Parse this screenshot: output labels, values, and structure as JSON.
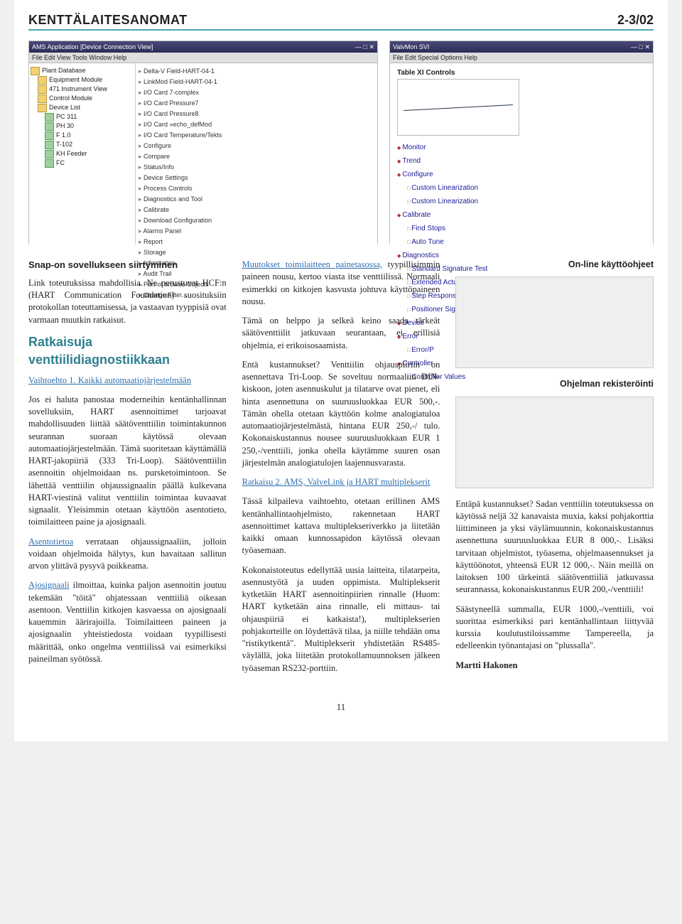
{
  "header": {
    "title": "KENTTÄLAITESANOMAT",
    "issue": "2-3/02"
  },
  "screenshots": {
    "left": {
      "window_title": "AMS Application  [Device Connection View]",
      "menubar": "File  Edit  View  Tools  Window  Help",
      "tree_items": [
        "Plant Database",
        "Equipment Module",
        "471 Instrument View",
        "Control Module",
        "Device List",
        "PC 311",
        "PH 30",
        "F 1.0",
        "T-102",
        "KH Feeder",
        "FC"
      ],
      "mid_items": [
        "Delta-V Field-HART-04-1",
        "LinkMod  Field-HART-04-1",
        "I/O Card  7-complex",
        "I/O Card  Pressure7",
        "I/O Card  Pressure8",
        "I/O Card  »echo_defMod",
        "I/O Card  Temperature/Tekts",
        "———————",
        "Configure",
        "Compare",
        "Status/Info",
        "Device Settings",
        "Process Controls",
        "Diagnostics and Tool",
        "Calibrate",
        "Download Configuration",
        "Alarms Panel",
        "Report",
        "Storage",
        "Information",
        "Audit Trail",
        "Part-of browse Objects",
        "Change Filter..."
      ]
    },
    "right": {
      "window_title": "ValvMon SVI",
      "menubar": "File  Edit  Special  Options  Help",
      "tabhead": "Table XI Controls",
      "menu": [
        "Monitor",
        "Trend",
        "Configure",
        "Calibrate",
        "Diagnostics",
        "Device",
        "Error",
        "Controller"
      ],
      "sub_configure": [
        "Custom Linearization",
        "Custom Linearization"
      ],
      "sub_calibrate": [
        "Find Stops",
        "Auto Tune"
      ],
      "sub_diagnostics": [
        "Standard Signature Test",
        "Extended Actuator Signature Test",
        "Step Response Test",
        "Positioner Signature"
      ],
      "sub_error": [
        "Error/P"
      ],
      "sub_controller": [
        "Controller Values"
      ]
    }
  },
  "article": {
    "snap_heading": "Snap-on sovellukseen siirtyminen",
    "snap_p": "Link toteutuksissa mahdollisia. Ne perustuvat HCF:n (HART Communication Foundation) suosituksiin protokollan toteuttamisessa, ja vastaavan tyyppisiä ovat varmaan muutkin ratkaisut.",
    "blue_heading": "Ratkaisuja venttiilidiagnostiikkaan",
    "opt1_link": "Vaihtoehto 1. Kaikki automaatiojärjestelmään",
    "opt1_p1": "Jos ei haluta panostaa moderneihin kentänhallinnan sovelluksiin, HART asennoittimet tarjoavat mahdollisuuden liittää säätöventtiilin toimintakunnon seurannan suoraan käytössä olevaan automaatiojärjestelmään. Tämä suoritetaan käyttämällä HART-jakopiiriä (333 Tri-Loop). Säätöventtiilin asennoitin ohjelmoidaan ns. pursketoimintoon. Se lähettää venttiilin ohjaussignaalin päällä kulkevana HART-viestinä valitut venttiilin toimintaa kuvaavat signaalit. Yleisimmin otetaan käyttöön asentotieto, toimilaitteen paine ja ajosignaali.",
    "opt1_p2_linkword": "Asentotietoa",
    "opt1_p2_rest": " verrataan ohjaussignaaliin, jolloin voidaan ohjelmoida hälytys, kun havaitaan sallitun arvon ylittävä pysyvä poikkeama.",
    "opt1_p3_linkword": "Ajosignaali",
    "opt1_p3_rest": " ilmoittaa, kuinka paljon asennoitin joutuu tekemään \"töitä\" ohjatessaan venttiiliä oikeaan asentoon. Venttiilin kitkojen kasvaessa on ajosignaali kauemmin äärirajoilla. Toimilaitteen paineen ja ajosignaalin yhteistiedosta voidaan tyypillisesti määrittää, onko ongelma venttiilissä vai esimerkiksi paineilman syötössä.",
    "col2_link1": "Muutokset toimilaitteen painetasossa,",
    "col2_p1_rest": " tyypillisimmin paineen nousu, kertoo viasta itse venttiilissä. Normaali esimerkki on kitkojen kasvusta johtuva käyttöpaineen nousu.",
    "col2_p2": "Tämä on helppo ja selkeä keino saada tärkeät säätöventtiilit jatkuvaan seurantaan, ei erillisiä ohjelmia, ei erikoisosaamista.",
    "col2_p3": "Entä kustannukset? Venttiilin ohjauspiiriin on asennettava Tri-Loop. Se soveltuu normaaliin DIN-kiskoon, joten asennuskulut ja tilatarve ovat pienet, eli hinta asennettuna on suuruusluokkaa EUR 500,-. Tämän ohella otetaan käyttöön kolme analogiatuloa automaatiojärjestelmästä, hintana EUR 250,-/ tulo. Kokonaiskustannus nousee suuruusluokkaan EUR 1 250,-/venttiili, jonka ohella käytämme suuren osan järjestelmän analogiatulojen laajennusvarasta.",
    "sol2_link": "Ratkaisu 2. AMS, ValveLink ja HART multiplekserit",
    "col2_p4": "Tässä kilpaileva vaihtoehto, otetaan erillinen AMS kentänhallintaohjelmisto, rakennetaan HART asennoittimet kattava multiplekseriverkko ja liitetään kaikki omaan kunnossapidon käytössä olevaan työasemaan.",
    "col2_p5": "Kokonaistoteutus edellyttää uusia laitteita, tilatarpeita, asennustyötä ja uuden oppimista. Multiplekserit kytketään HART asennoitinpiirien rinnalle (Huom: HART kytketään aina rinnalle, eli mittaus- tai ohjauspiiriä ei katkaista!), multiplekserien pohjakorteille on löydettävä tilaa, ja niille tehdään oma \"ristikytkentä\". Multiplekserit yhdistetään RS485-väylällä, joka liitetään protokollamuunnoksen jälkeen työaseman RS232-porttiin.",
    "side1_heading": "On-line käyttöohjeet",
    "side2_heading": "Ohjelman rekisteröinti",
    "col3_p1": "Entäpä kustannukset? Sadan venttiilin toteutuksessa on käytössä neljä 32 kanavaista muxia, kaksi pohjakorttia liittimineen ja yksi väylämuunnin, kokonaiskustannus asennettuna suuruusluokkaa EUR 8 000,-. Lisäksi tarvitaan ohjelmistot, työasema, ohjelmaasennukset ja käyttöönotot, yhteensä EUR 12 000,-. Näin meillä on laitoksen 100 tärkeintä säätöventtiiliä jatkuvassa seurannassa, kokonaiskustannus EUR 200,-/venttiili!",
    "col3_p2": "Säästyneellä summalla, EUR 1000,-/venttiili, voi suorittaa esimerkiksi pari kentänhallintaan liittyvää kurssia koulutustiloissamme Tampereella, ja edelleenkin työnantajasi on \"plussalla\".",
    "author": "Martti Hakonen"
  },
  "page_number": "11"
}
